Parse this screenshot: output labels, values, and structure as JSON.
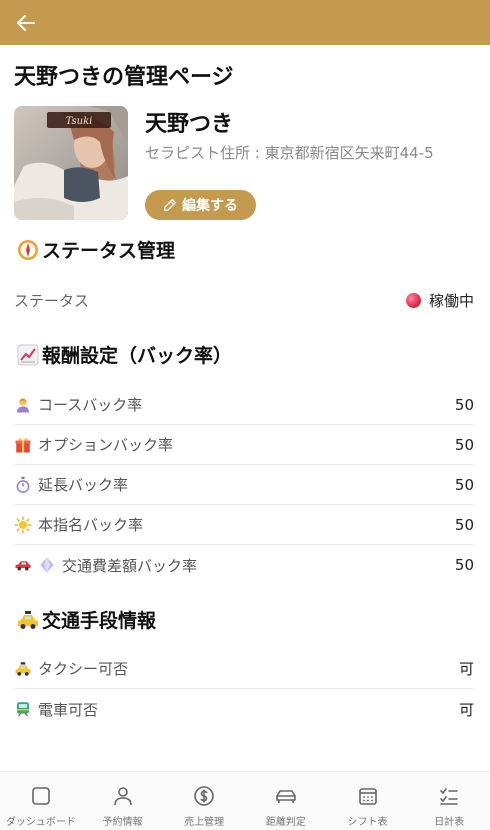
{
  "header": {
    "back_icon": "arrow-left-icon",
    "bar_color": "#c49a4f"
  },
  "page": {
    "title": "天野つきの管理ページ"
  },
  "profile": {
    "avatar_badge": "Tsuki",
    "name": "天野つき",
    "address": "セラピスト住所 : 東京都新宿区矢来町44-5",
    "edit_label": "編集する"
  },
  "status_section": {
    "title": "ステータス管理",
    "icon": "compass-icon",
    "label": "ステータス",
    "value": "稼働中",
    "dot_color": "#e0284a"
  },
  "reward_section": {
    "title": "報酬設定（バック率）",
    "icon": "chart-up-icon",
    "items": [
      {
        "icon": "person-icon",
        "label": "コースバック率",
        "value": "50"
      },
      {
        "icon": "gift-icon",
        "label": "オプションバック率",
        "value": "50"
      },
      {
        "icon": "stopwatch-icon",
        "label": "延長バック率",
        "value": "50"
      },
      {
        "icon": "sun-icon",
        "label": "本指名バック率",
        "value": "50"
      },
      {
        "icon": "car-icon",
        "label": "交通費差額バック率",
        "value": "50"
      }
    ]
  },
  "transport_section": {
    "title": "交通手段情報",
    "icon": "taxi-icon",
    "items": [
      {
        "icon": "taxi-icon",
        "label": "タクシー可否",
        "value": "可"
      },
      {
        "icon": "train-icon",
        "label": "電車可否",
        "value": "可"
      }
    ]
  },
  "bottom_nav": [
    {
      "icon": "square-icon",
      "label": "ダッシュボード"
    },
    {
      "icon": "user-icon",
      "label": "予約情報"
    },
    {
      "icon": "dollar-circle-icon",
      "label": "売上管理"
    },
    {
      "icon": "car-outline-icon",
      "label": "距離判定"
    },
    {
      "icon": "calendar-icon",
      "label": "シフト表"
    },
    {
      "icon": "checklist-icon",
      "label": "日計表"
    }
  ]
}
